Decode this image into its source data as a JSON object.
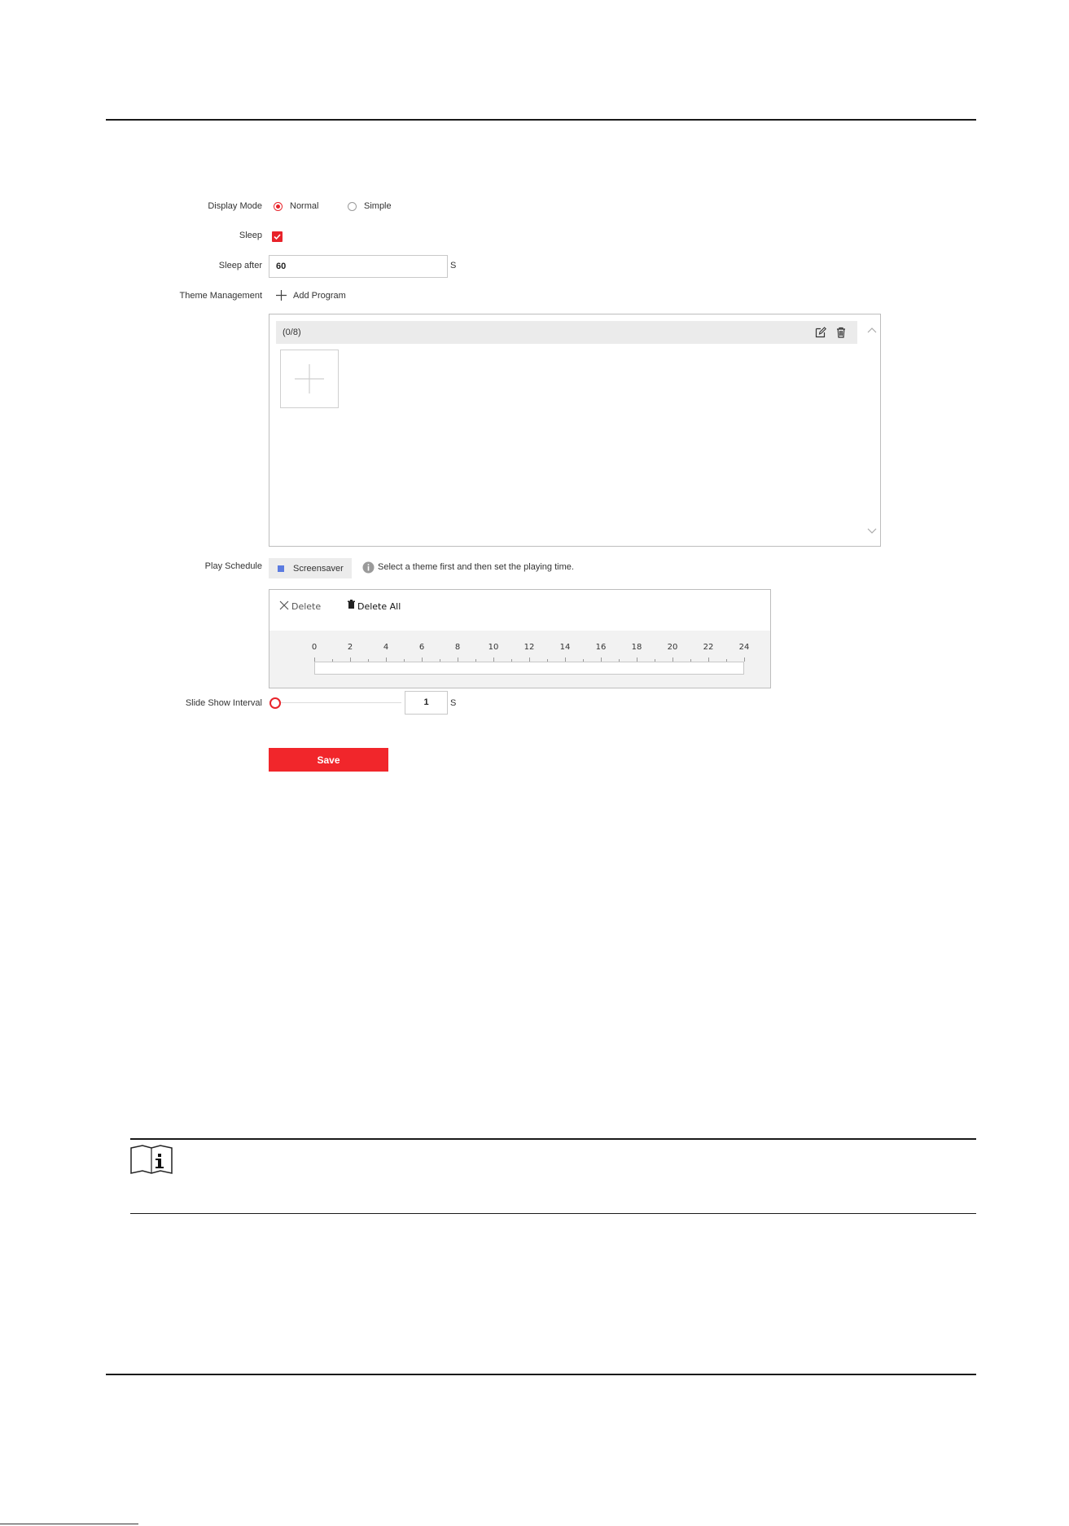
{
  "form": {
    "display_mode": {
      "label": "Display Mode",
      "options": [
        {
          "label": "Normal",
          "selected": true
        },
        {
          "label": "Simple",
          "selected": false
        }
      ]
    },
    "sleep": {
      "label": "Sleep",
      "checked": true
    },
    "sleep_after": {
      "label": "Sleep after",
      "value": "60",
      "unit": "S"
    },
    "theme_management": {
      "label": "Theme Management",
      "add_program_label": "Add Program",
      "count_label": "(0/8)"
    },
    "play_schedule": {
      "label": "Play Schedule",
      "tag_label": "Screensaver",
      "tag_color": "#5b7be0",
      "hint": "Select a theme first and then set the playing time.",
      "delete_label": "Delete",
      "delete_all_label": "Delete All",
      "scale": [
        "0",
        "2",
        "4",
        "6",
        "8",
        "10",
        "12",
        "14",
        "16",
        "18",
        "20",
        "22",
        "24"
      ]
    },
    "slide_show_interval": {
      "label": "Slide Show Interval",
      "value": "1",
      "unit": "S",
      "slider_level": 0
    },
    "save_label": "Save"
  },
  "colors": {
    "accent": "#e8232a",
    "save_button": "#f1262b"
  }
}
